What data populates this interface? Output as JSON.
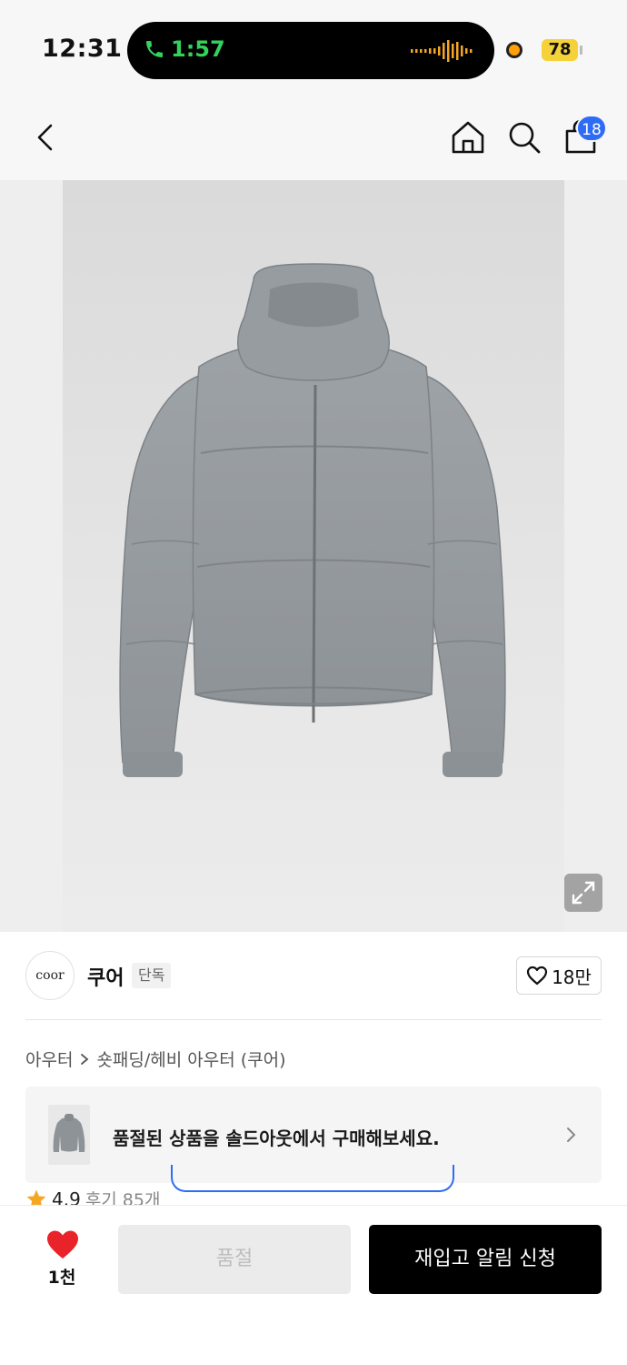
{
  "status_bar": {
    "time": "12:31",
    "call_duration": "1:57",
    "battery": "78"
  },
  "nav": {
    "cart_count": "18"
  },
  "brand": {
    "logo_text": "coor",
    "name": "쿠어",
    "exclusive_tag": "단독",
    "likes": "18만"
  },
  "breadcrumb": {
    "category": "아우터",
    "subcategory": "숏패딩/헤비 아우터 (쿠어)"
  },
  "soldout_banner": {
    "text": "품절된 상품을 솔드아웃에서 구매해보세요."
  },
  "rating": {
    "score": "4.9",
    "reviews": "후기 85개"
  },
  "bottom_bar": {
    "wish_count": "1천",
    "soldout_label": "품절",
    "restock_label": "재입고 알림 신청"
  },
  "colors": {
    "accent_blue": "#2f6cf6",
    "heart_red": "#e8232a",
    "call_green": "#33d35a",
    "star_orange": "#f5a623"
  },
  "icons": [
    "back-icon",
    "home-icon",
    "search-icon",
    "bag-icon",
    "expand-icon",
    "heart-outline-icon",
    "chevron-right-icon",
    "star-icon",
    "heart-filled-icon",
    "phone-icon"
  ]
}
